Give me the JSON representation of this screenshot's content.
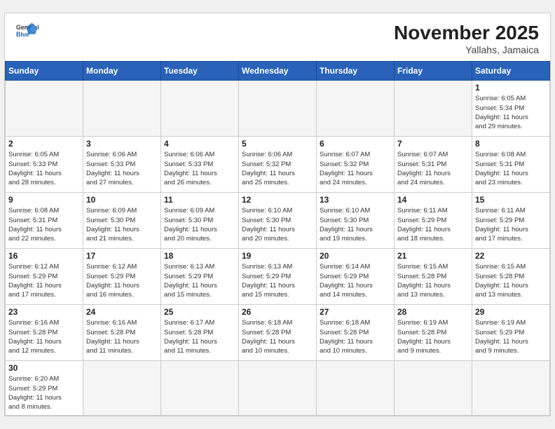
{
  "header": {
    "logo_general": "General",
    "logo_blue": "Blue",
    "month_title": "November 2025",
    "subtitle": "Yallahs, Jamaica"
  },
  "days_of_week": [
    "Sunday",
    "Monday",
    "Tuesday",
    "Wednesday",
    "Thursday",
    "Friday",
    "Saturday"
  ],
  "weeks": [
    [
      {
        "day": "",
        "info": ""
      },
      {
        "day": "",
        "info": ""
      },
      {
        "day": "",
        "info": ""
      },
      {
        "day": "",
        "info": ""
      },
      {
        "day": "",
        "info": ""
      },
      {
        "day": "",
        "info": ""
      },
      {
        "day": "1",
        "info": "Sunrise: 6:05 AM\nSunset: 5:34 PM\nDaylight: 11 hours\nand 29 minutes."
      }
    ],
    [
      {
        "day": "2",
        "info": "Sunrise: 6:05 AM\nSunset: 5:33 PM\nDaylight: 11 hours\nand 28 minutes."
      },
      {
        "day": "3",
        "info": "Sunrise: 6:06 AM\nSunset: 5:33 PM\nDaylight: 11 hours\nand 27 minutes."
      },
      {
        "day": "4",
        "info": "Sunrise: 6:06 AM\nSunset: 5:33 PM\nDaylight: 11 hours\nand 26 minutes."
      },
      {
        "day": "5",
        "info": "Sunrise: 6:06 AM\nSunset: 5:32 PM\nDaylight: 11 hours\nand 25 minutes."
      },
      {
        "day": "6",
        "info": "Sunrise: 6:07 AM\nSunset: 5:32 PM\nDaylight: 11 hours\nand 24 minutes."
      },
      {
        "day": "7",
        "info": "Sunrise: 6:07 AM\nSunset: 5:31 PM\nDaylight: 11 hours\nand 24 minutes."
      },
      {
        "day": "8",
        "info": "Sunrise: 6:08 AM\nSunset: 5:31 PM\nDaylight: 11 hours\nand 23 minutes."
      }
    ],
    [
      {
        "day": "9",
        "info": "Sunrise: 6:08 AM\nSunset: 5:31 PM\nDaylight: 11 hours\nand 22 minutes."
      },
      {
        "day": "10",
        "info": "Sunrise: 6:09 AM\nSunset: 5:30 PM\nDaylight: 11 hours\nand 21 minutes."
      },
      {
        "day": "11",
        "info": "Sunrise: 6:09 AM\nSunset: 5:30 PM\nDaylight: 11 hours\nand 20 minutes."
      },
      {
        "day": "12",
        "info": "Sunrise: 6:10 AM\nSunset: 5:30 PM\nDaylight: 11 hours\nand 20 minutes."
      },
      {
        "day": "13",
        "info": "Sunrise: 6:10 AM\nSunset: 5:30 PM\nDaylight: 11 hours\nand 19 minutes."
      },
      {
        "day": "14",
        "info": "Sunrise: 6:11 AM\nSunset: 5:29 PM\nDaylight: 11 hours\nand 18 minutes."
      },
      {
        "day": "15",
        "info": "Sunrise: 6:11 AM\nSunset: 5:29 PM\nDaylight: 11 hours\nand 17 minutes."
      }
    ],
    [
      {
        "day": "16",
        "info": "Sunrise: 6:12 AM\nSunset: 5:29 PM\nDaylight: 11 hours\nand 17 minutes."
      },
      {
        "day": "17",
        "info": "Sunrise: 6:12 AM\nSunset: 5:29 PM\nDaylight: 11 hours\nand 16 minutes."
      },
      {
        "day": "18",
        "info": "Sunrise: 6:13 AM\nSunset: 5:29 PM\nDaylight: 11 hours\nand 15 minutes."
      },
      {
        "day": "19",
        "info": "Sunrise: 6:13 AM\nSunset: 5:29 PM\nDaylight: 11 hours\nand 15 minutes."
      },
      {
        "day": "20",
        "info": "Sunrise: 6:14 AM\nSunset: 5:29 PM\nDaylight: 11 hours\nand 14 minutes."
      },
      {
        "day": "21",
        "info": "Sunrise: 6:15 AM\nSunset: 5:28 PM\nDaylight: 11 hours\nand 13 minutes."
      },
      {
        "day": "22",
        "info": "Sunrise: 6:15 AM\nSunset: 5:28 PM\nDaylight: 11 hours\nand 13 minutes."
      }
    ],
    [
      {
        "day": "23",
        "info": "Sunrise: 6:16 AM\nSunset: 5:28 PM\nDaylight: 11 hours\nand 12 minutes."
      },
      {
        "day": "24",
        "info": "Sunrise: 6:16 AM\nSunset: 5:28 PM\nDaylight: 11 hours\nand 11 minutes."
      },
      {
        "day": "25",
        "info": "Sunrise: 6:17 AM\nSunset: 5:28 PM\nDaylight: 11 hours\nand 11 minutes."
      },
      {
        "day": "26",
        "info": "Sunrise: 6:18 AM\nSunset: 5:28 PM\nDaylight: 11 hours\nand 10 minutes."
      },
      {
        "day": "27",
        "info": "Sunrise: 6:18 AM\nSunset: 5:28 PM\nDaylight: 11 hours\nand 10 minutes."
      },
      {
        "day": "28",
        "info": "Sunrise: 6:19 AM\nSunset: 5:28 PM\nDaylight: 11 hours\nand 9 minutes."
      },
      {
        "day": "29",
        "info": "Sunrise: 6:19 AM\nSunset: 5:29 PM\nDaylight: 11 hours\nand 9 minutes."
      }
    ],
    [
      {
        "day": "30",
        "info": "Sunrise: 6:20 AM\nSunset: 5:29 PM\nDaylight: 11 hours\nand 8 minutes."
      },
      {
        "day": "",
        "info": ""
      },
      {
        "day": "",
        "info": ""
      },
      {
        "day": "",
        "info": ""
      },
      {
        "day": "",
        "info": ""
      },
      {
        "day": "",
        "info": ""
      },
      {
        "day": "",
        "info": ""
      }
    ]
  ]
}
